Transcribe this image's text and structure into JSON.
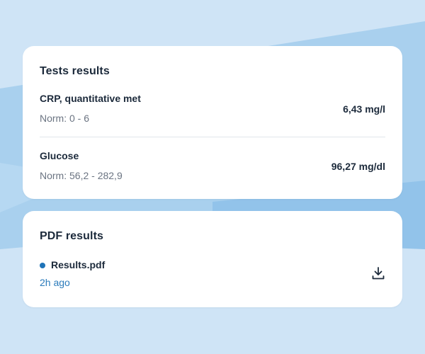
{
  "tests_card": {
    "title": "Tests results",
    "results": [
      {
        "name": "CRP, quantitative met",
        "norm": "Norm: 0 - 6",
        "value": "6,43 mg/l"
      },
      {
        "name": "Glucose",
        "norm": "Norm: 56,2 - 282,9",
        "value": "96,27 mg/dl"
      }
    ]
  },
  "pdf_card": {
    "title": "PDF results",
    "file": {
      "name": "Results.pdf",
      "time": "2h ago",
      "status_color": "#1f74b8",
      "action_icon": "download-icon"
    }
  },
  "colors": {
    "background": "#cfe4f6",
    "accent_band": "#9cc8ea",
    "card": "#ffffff",
    "text_primary": "#1c2a3b",
    "text_secondary": "#6b7482",
    "link": "#2b7bbb"
  }
}
